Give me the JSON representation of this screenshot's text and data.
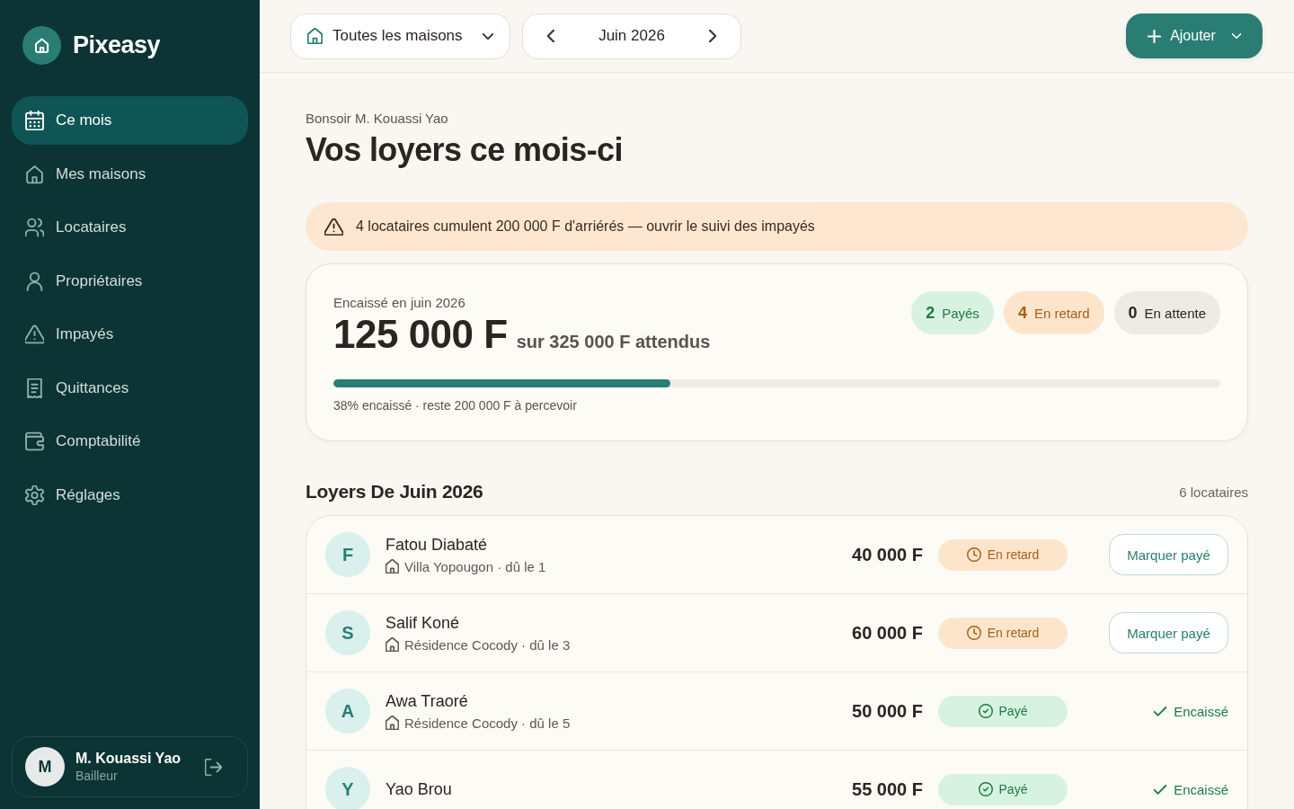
{
  "sidebar": {
    "brand": "Pixeasy",
    "items": [
      {
        "label": "Ce mois",
        "selected": true
      },
      {
        "label": "Mes maisons",
        "selected": false
      },
      {
        "label": "Locataires",
        "selected": false
      },
      {
        "label": "Propriétaires",
        "selected": false
      },
      {
        "label": "Impayés",
        "selected": false
      },
      {
        "label": "Quittances",
        "selected": false
      },
      {
        "label": "Comptabilité",
        "selected": false
      },
      {
        "label": "Réglages",
        "selected": false
      }
    ],
    "user": {
      "initial": "M",
      "name": "M. Kouassi Yao",
      "role": "Bailleur"
    }
  },
  "topbar": {
    "house_filter": {
      "label": "Toutes les maisons"
    },
    "period": {
      "label": "Juin 2026"
    },
    "add_button": {
      "label": "Ajouter"
    }
  },
  "header": {
    "greeting": "Bonsoir M. Kouassi Yao",
    "title": "Vos loyers ce mois-ci"
  },
  "alert": {
    "text": "4 locataires cumulent 200 000 F d'arriérés — ouvrir le suivi des impayés"
  },
  "summary": {
    "caption": "Encaissé en juin 2026",
    "amount": "125 000 F",
    "expected": "sur 325 000 F attendus",
    "chips": [
      {
        "kind": "paid",
        "count": "2",
        "label": "Payés"
      },
      {
        "kind": "late",
        "count": "4",
        "label": "En retard"
      },
      {
        "kind": "pending",
        "count": "0",
        "label": "En attente"
      }
    ],
    "level": 0.38,
    "progress_text": "38% encaissé · reste 200 000 F à percevoir"
  },
  "rents": {
    "title": "Loyers De Juin 2026",
    "count": "6 locataires",
    "rows": [
      {
        "initial": "F",
        "name": "Fatou Diabaté",
        "place": "Villa Yopougon · dû le 1",
        "amount": "40 000 F",
        "status": {
          "kind": "late",
          "label": "En retard"
        },
        "action": {
          "kind": "button",
          "label": "Marquer payé"
        }
      },
      {
        "initial": "S",
        "name": "Salif Koné",
        "place": "Résidence Cocody · dû le 3",
        "amount": "60 000 F",
        "status": {
          "kind": "late",
          "label": "En retard"
        },
        "action": {
          "kind": "button",
          "label": "Marquer payé"
        }
      },
      {
        "initial": "A",
        "name": "Awa Traoré",
        "place": "Résidence Cocody · dû le 5",
        "amount": "50 000 F",
        "status": {
          "kind": "paid",
          "label": "Payé"
        },
        "action": {
          "kind": "done",
          "label": "Encaissé"
        }
      },
      {
        "initial": "Y",
        "name": "Yao Brou",
        "amount": "55 000 F",
        "status": {
          "kind": "paid",
          "label": "Payé"
        },
        "action": {
          "kind": "done",
          "label": "Encaissé"
        }
      }
    ]
  }
}
